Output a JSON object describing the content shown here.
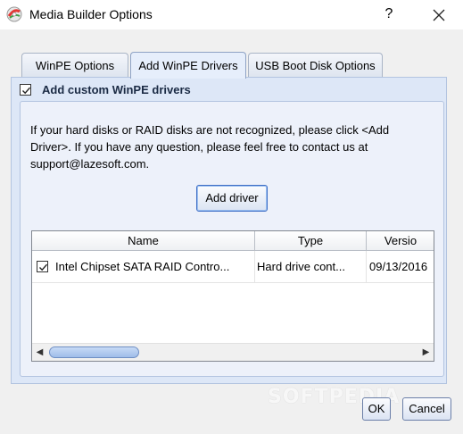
{
  "window": {
    "title": "Media Builder Options",
    "help": "?"
  },
  "tabs": [
    {
      "label": "WinPE Options",
      "active": false
    },
    {
      "label": "Add WinPE Drivers",
      "active": true
    },
    {
      "label": "USB Boot Disk Options",
      "active": false
    }
  ],
  "group": {
    "checkbox_label": "Add custom WinPE drivers",
    "checked": true,
    "description": "If your hard disks or RAID disks are not recognized, please click <Add Driver>. If you have any question, please feel free to contact us at support@lazesoft.com.",
    "add_driver_label": "Add driver"
  },
  "table": {
    "columns": [
      "Name",
      "Type",
      "Versio"
    ],
    "rows": [
      {
        "checked": true,
        "name": "Intel Chipset SATA RAID Contro...",
        "type": "Hard drive cont...",
        "version": "09/13/2016"
      }
    ]
  },
  "buttons": {
    "ok": "OK",
    "cancel": "Cancel"
  },
  "watermark": "SOFTPEDIA",
  "colors": {
    "panel": "#dde7f7",
    "accent": "#3f6fc6"
  },
  "icons": [
    "app-icon",
    "close-icon",
    "checkmark-icon",
    "scroll-left-icon",
    "scroll-right-icon"
  ]
}
